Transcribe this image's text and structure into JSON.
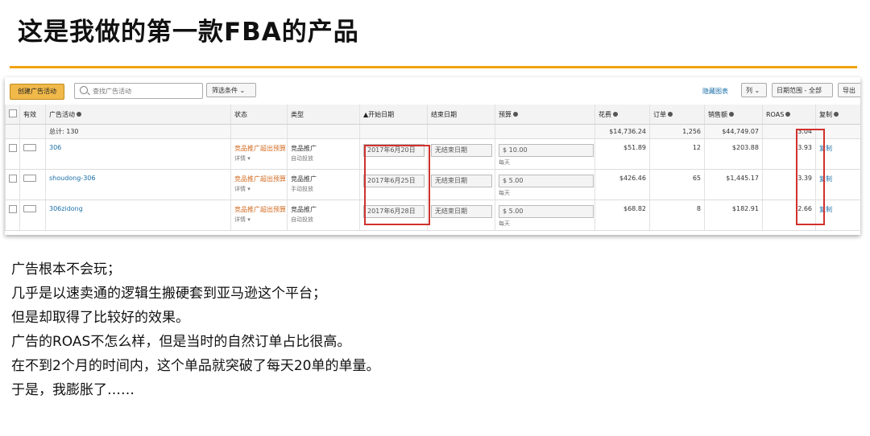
{
  "slide": {
    "title": "这是我做的第一款FBA的产品",
    "accent_color": "#f0a30a",
    "notes": [
      "广告根本不会玩；",
      "几乎是以速卖通的逻辑生搬硬套到亚马逊这个平台；",
      "但是却取得了比较好的效果。",
      "广告的ROAS不怎么样，但是当时的自然订单占比很高。",
      "在不到2个月的时间内，这个单品就突破了每天20单的单量。",
      "于是，我膨胀了……"
    ]
  },
  "toolbar": {
    "create_label": "创建广告活动",
    "search_placeholder": "查找广告活动",
    "filter_label": "筛选条件 ⌄",
    "hide_chart_label": "隐藏图表",
    "columns_label": "列 ⌄",
    "date_range_label": "日期范围 - 全部",
    "export_label": "导出"
  },
  "table": {
    "headers": {
      "active": "有效",
      "campaign": "广告活动",
      "status": "状态",
      "type": "类型",
      "start_date": "▲开始日期",
      "end_date": "结束日期",
      "budget": "预算",
      "spend": "花费",
      "orders": "订单",
      "sales": "销售额",
      "roas": "ROAS",
      "copy": "复制"
    },
    "totals": {
      "label": "总计: 130",
      "spend": "$14,736.24",
      "orders": "1,256",
      "sales": "$44,749.07",
      "roas": "3.04"
    },
    "rows": [
      {
        "name": "306",
        "status": "竞品推广超出预算",
        "status_sub": "详情 ▾",
        "type": "竞品推广",
        "type_sub": "自动投放",
        "start": "2017年6月20日",
        "end": "无结束日期",
        "budget": "$  10.00",
        "budget_sub": "每天",
        "spend": "$51.89",
        "orders": "12",
        "sales": "$203.88",
        "roas": "3.93",
        "copy": "复制"
      },
      {
        "name": "shoudong-306",
        "status": "竞品推广超出预算",
        "status_sub": "详情 ▾",
        "type": "竞品推广",
        "type_sub": "手动投放",
        "start": "2017年6月25日",
        "end": "无结束日期",
        "budget": "$  5.00",
        "budget_sub": "每天",
        "spend": "$426.46",
        "orders": "65",
        "sales": "$1,445.17",
        "roas": "3.39",
        "copy": "复制"
      },
      {
        "name": "306zidong",
        "status": "竞品推广超出预算",
        "status_sub": "详情 ▾",
        "type": "竞品推广",
        "type_sub": "自动投放",
        "start": "2017年6月28日",
        "end": "无结束日期",
        "budget": "$  5.00",
        "budget_sub": "每天",
        "spend": "$68.82",
        "orders": "8",
        "sales": "$182.91",
        "roas": "2.66",
        "copy": "复制"
      }
    ]
  },
  "colors": {
    "highlight": "#d0312d",
    "link": "#1a6fa8",
    "status": "#d2691e",
    "create_button": "#f0b94a"
  }
}
